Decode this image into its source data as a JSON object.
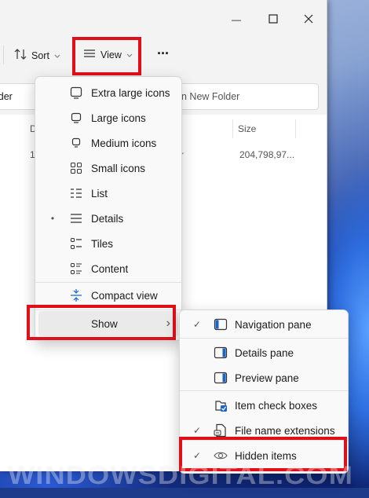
{
  "window": {
    "minimize_glyph": "—",
    "maximize_glyph": "□",
    "close_glyph": "✕"
  },
  "toolbar": {
    "sort_label": "Sort",
    "view_label": "View",
    "more_label": "···"
  },
  "address": {
    "left_text": "lder",
    "search_text": "n New Folder"
  },
  "file_list": {
    "columns": [
      "D",
      "Size"
    ],
    "rows": [
      {
        "name_fragment": "1",
        "type_fragment": "r",
        "size": "204,798,97..."
      }
    ]
  },
  "view_menu": {
    "items": [
      {
        "label": "Extra large icons",
        "icon": "extra-large-icons-icon",
        "selected": false
      },
      {
        "label": "Large icons",
        "icon": "large-icons-icon",
        "selected": false
      },
      {
        "label": "Medium icons",
        "icon": "medium-icons-icon",
        "selected": false
      },
      {
        "label": "Small icons",
        "icon": "small-icons-icon",
        "selected": false
      },
      {
        "label": "List",
        "icon": "list-icon",
        "selected": false
      },
      {
        "label": "Details",
        "icon": "details-icon",
        "selected": true
      },
      {
        "label": "Tiles",
        "icon": "tiles-icon",
        "selected": false
      },
      {
        "label": "Content",
        "icon": "content-icon",
        "selected": false
      }
    ],
    "compact_label": "Compact view",
    "show_label": "Show",
    "selected_bullet": "•",
    "submenu_arrow": "›"
  },
  "show_menu": {
    "items": [
      {
        "label": "Navigation pane",
        "checked": true,
        "icon": "navigation-pane-icon"
      },
      {
        "label": "Details pane",
        "checked": false,
        "icon": "details-pane-icon"
      },
      {
        "label": "Preview pane",
        "checked": false,
        "icon": "preview-pane-icon"
      },
      {
        "label": "Item check boxes",
        "checked": false,
        "icon": "item-check-boxes-icon"
      },
      {
        "label": "File name extensions",
        "checked": true,
        "icon": "file-name-extensions-icon"
      },
      {
        "label": "Hidden items",
        "checked": true,
        "icon": "hidden-items-icon"
      }
    ],
    "check_glyph": "✓"
  },
  "watermark": "WindowsDigital.com",
  "colors": {
    "highlight_red": "#e0101a",
    "accent_blue": "#005fb8"
  }
}
